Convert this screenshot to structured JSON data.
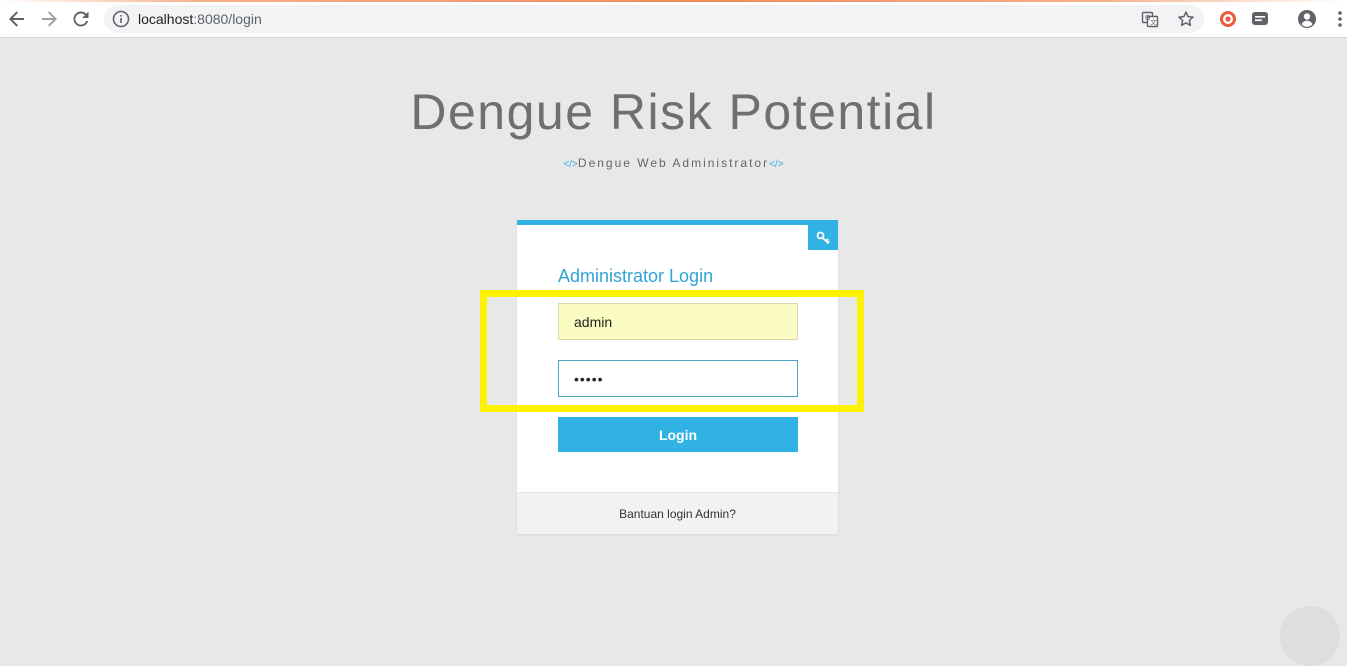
{
  "browser": {
    "url_host": "localhost",
    "url_path": ":8080/login",
    "icons": {
      "back": "back-arrow-icon",
      "forward": "forward-arrow-icon",
      "reload": "reload-icon",
      "info": "info-icon",
      "translate": "translate-icon",
      "bookmark": "star-icon",
      "extension_1": "record-icon",
      "extension_2": "chat-icon",
      "profile": "account-icon",
      "menu": "more-vert-icon"
    }
  },
  "page": {
    "title": "Dengue Risk Potential",
    "subtitle_prefix": "</>",
    "subtitle": "Dengue Web Administrator",
    "subtitle_suffix": "</>"
  },
  "login": {
    "heading": "Administrator Login",
    "username_value": "admin",
    "password_value": "admin",
    "button_label": "Login",
    "help_link": "Bantuan login Admin?",
    "key_icon": "key-icon"
  },
  "colors": {
    "accent": "#30b3e4",
    "heading": "#30a5d6",
    "highlight": "#fff200",
    "background": "#e8e8e8",
    "autofill": "#fbfcc1"
  }
}
